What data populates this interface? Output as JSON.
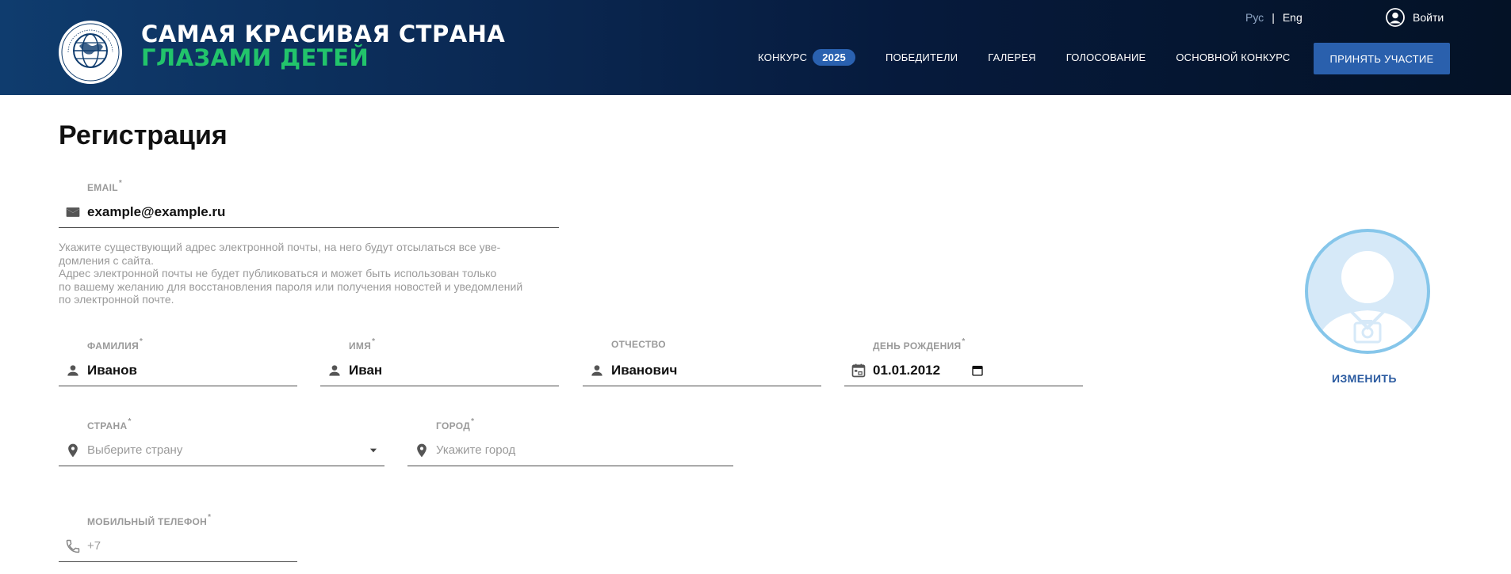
{
  "header": {
    "title_line1": "САМАЯ КРАСИВАЯ СТРАНА",
    "title_line2": "ГЛАЗАМИ ДЕТЕЙ",
    "lang_ru": "Рус",
    "lang_sep": "|",
    "lang_en": "Eng",
    "login_label": "Войти",
    "nav": {
      "contest_label": "КОНКУРС",
      "contest_year": "2025",
      "winners": "ПОБЕДИТЕЛИ",
      "gallery": "ГАЛЕРЕЯ",
      "voting": "ГОЛОСОВАНИЕ",
      "main_contest": "ОСНОВНОЙ КОНКУРС"
    },
    "cta_label": "ПРИНЯТЬ УЧАСТИЕ",
    "colors": {
      "accent": "#2a60ad",
      "title_green": "#22c46b"
    }
  },
  "page": {
    "title": "Регистрация"
  },
  "form": {
    "email": {
      "label": "EMAIL",
      "required": "*",
      "value": "example@example.ru",
      "icon": "mail-icon"
    },
    "email_help": [
      "Укажите существующий адрес электронной почты, на него будут отсылаться все уве-",
      "домления с сайта.",
      "Адрес электронной почты не будет публиковаться и может быть использован только",
      "по вашему желанию для восстановления пароля или получения новостей и уведомлений",
      "по электронной почте."
    ],
    "last_name": {
      "label": "ФАМИЛИЯ",
      "required": "*",
      "value": "Иванов",
      "icon": "person-icon"
    },
    "first_name": {
      "label": "ИМЯ",
      "required": "*",
      "value": "Иван",
      "icon": "person-icon"
    },
    "patronymic": {
      "label": "ОТЧЕСТВО",
      "value": "Иванович",
      "icon": "person-icon"
    },
    "birthday": {
      "label": "ДЕНЬ РОЖДЕНИЯ",
      "required": "*",
      "value": "01.01.2012",
      "icon": "calendar-icon"
    },
    "country": {
      "label": "СТРАНА",
      "required": "*",
      "placeholder": "Выберите страну",
      "icon": "location-pin-icon"
    },
    "city": {
      "label": "ГОРОД",
      "required": "*",
      "placeholder": "Укажите город",
      "icon": "location-pin-icon"
    },
    "phone": {
      "label": "МОБИЛЬНЫЙ ТЕЛЕФОН",
      "required": "*",
      "placeholder": "+7",
      "icon": "phone-icon"
    }
  },
  "avatar": {
    "change_label": "ИЗМЕНИТЬ"
  }
}
